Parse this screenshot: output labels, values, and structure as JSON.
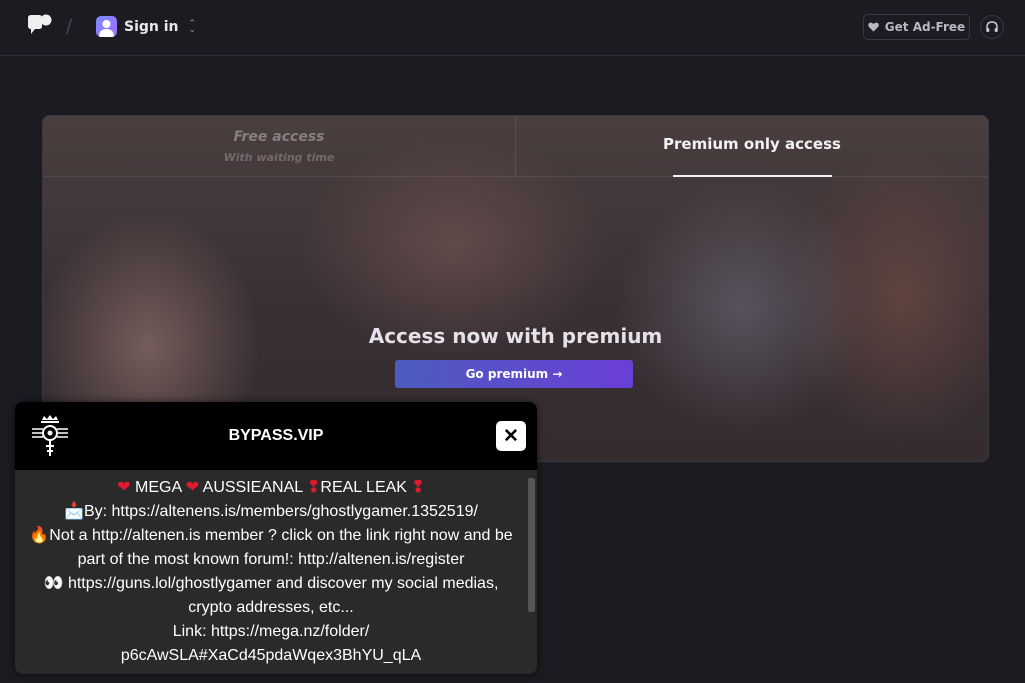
{
  "header": {
    "signin_label": "Sign in",
    "adfree_label": "Get Ad-Free",
    "slash": "/"
  },
  "tabs": {
    "free_title": "Free access",
    "free_subtitle": "With waiting time",
    "premium_title": "Premium only access"
  },
  "main": {
    "heading": "Access now with premium",
    "go_premium_label": "Go premium →"
  },
  "popup": {
    "title": "BYPASS.VIP",
    "close_label": "✕",
    "line1": {
      "heart1": "❤",
      "text1": " MEGA ",
      "heart2": "❤",
      "text2": " AUSSIEANAL ",
      "excl1": "❢",
      "text3": "REAL LEAK ",
      "excl2": "❢"
    },
    "line2_icon": "📩",
    "line2": "By: https://altenens.is/members/ghostlygamer.1352519/",
    "line3_icon": "🔥",
    "line3": "Not a http://altenen.is member ? click on the link right now and be part of the most known forum!: http://altenen.is/register",
    "line4_icon": "👀",
    "line4": " https://guns.lol/ghostlygamer and discover my social medias, crypto addresses, etc...",
    "line5": "Link: https://mega.nz/folder/ p6cAwSLA#XaCd45pdaWqex3BhYU_qLA"
  },
  "colors": {
    "background": "#1c1b22",
    "accent_start": "#4d5bbf",
    "accent_end": "#6a3fd6",
    "popup_bg": "#2a2a2a",
    "heart": "#e0192f"
  },
  "icons": [
    "chat-logo-icon",
    "avatar-icon",
    "chevron-updown-icon",
    "heart-icon",
    "headset-icon",
    "close-icon",
    "bypass-logo-icon"
  ]
}
